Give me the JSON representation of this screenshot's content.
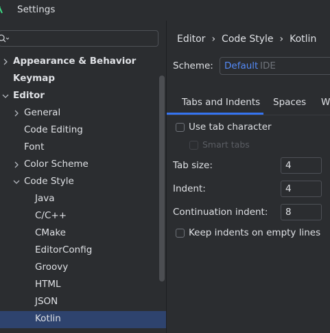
{
  "window": {
    "title": "Settings"
  },
  "search": {
    "placeholder": ""
  },
  "tree": [
    {
      "label": "Appearance & Behavior",
      "bold": true,
      "expander": "right"
    },
    {
      "label": "Keymap",
      "bold": true,
      "expander": ""
    },
    {
      "label": "Editor",
      "bold": true,
      "expander": "down"
    },
    {
      "label": "General",
      "bold": false,
      "expander": "right"
    },
    {
      "label": "Code Editing",
      "bold": false,
      "expander": ""
    },
    {
      "label": "Font",
      "bold": false,
      "expander": ""
    },
    {
      "label": "Color Scheme",
      "bold": false,
      "expander": "right"
    },
    {
      "label": "Code Style",
      "bold": false,
      "expander": "down"
    },
    {
      "label": "Java",
      "bold": false,
      "expander": ""
    },
    {
      "label": "C/C++",
      "bold": false,
      "expander": ""
    },
    {
      "label": "CMake",
      "bold": false,
      "expander": ""
    },
    {
      "label": "EditorConfig",
      "bold": false,
      "expander": ""
    },
    {
      "label": "Groovy",
      "bold": false,
      "expander": ""
    },
    {
      "label": "HTML",
      "bold": false,
      "expander": ""
    },
    {
      "label": "JSON",
      "bold": false,
      "expander": ""
    },
    {
      "label": "Kotlin",
      "bold": false,
      "expander": "",
      "selected": true
    }
  ],
  "breadcrumb": [
    "Editor",
    "Code Style",
    "Kotlin"
  ],
  "scheme": {
    "label": "Scheme:",
    "name": "Default",
    "type": "IDE"
  },
  "tabs": [
    "Tabs and Indents",
    "Spaces",
    "W"
  ],
  "options": {
    "use_tab_character": "Use tab character",
    "smart_tabs": "Smart tabs",
    "tab_size_label": "Tab size:",
    "tab_size_value": "4",
    "indent_label": "Indent:",
    "indent_value": "4",
    "continuation_indent_label": "Continuation indent:",
    "continuation_indent_value": "8",
    "keep_indents_empty_lines": "Keep indents on empty lines"
  },
  "colors": {
    "background": "#2b2d30",
    "selection": "#2e436e",
    "accent": "#3574f0",
    "scheme_name": "#548af7"
  }
}
